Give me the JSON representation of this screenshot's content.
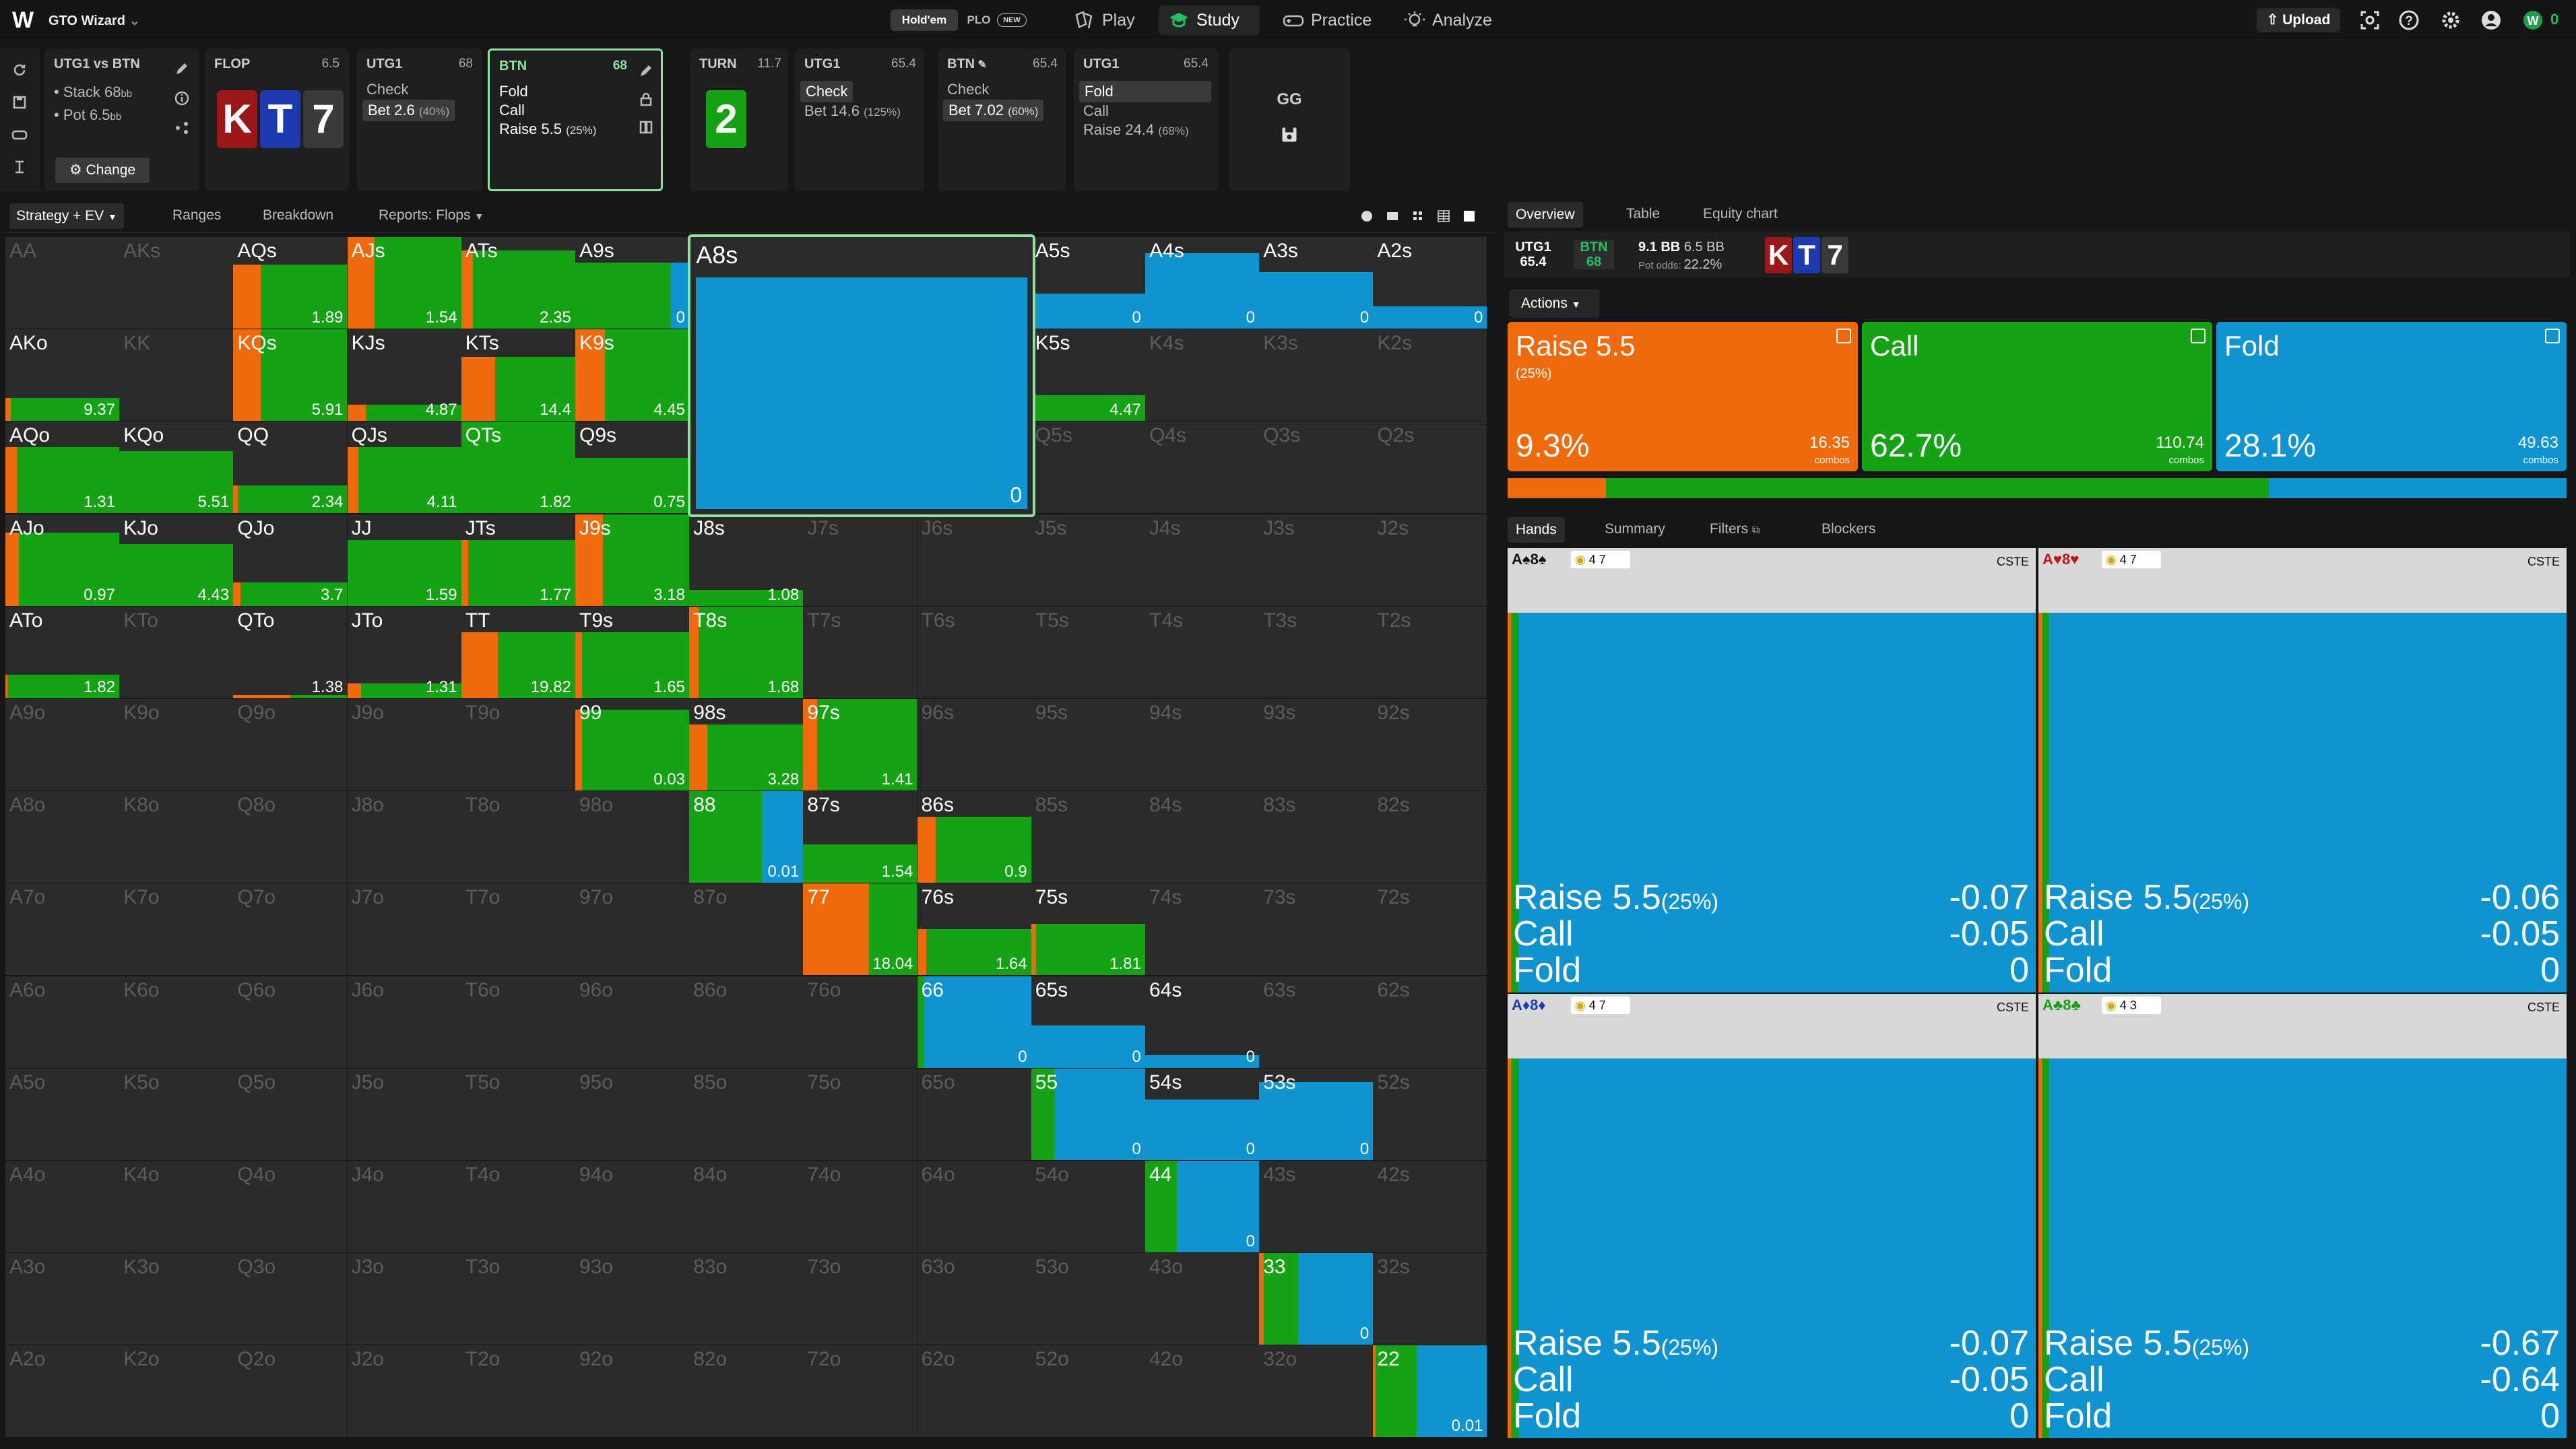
{
  "app": {
    "title": "GTO Wizard"
  },
  "topbar": {
    "toggle": [
      "Hold'em",
      "PLO",
      "NEW"
    ],
    "nav": [
      {
        "label": "Play",
        "icon": "spade-icon"
      },
      {
        "label": "Study",
        "icon": "study-icon",
        "active": true
      },
      {
        "label": "Practice",
        "icon": "gamepad-icon"
      },
      {
        "label": "Analyze",
        "icon": "bulb-icon"
      }
    ],
    "upload": "Upload",
    "right_icons": [
      "scan-icon",
      "help-icon",
      "settings-icon",
      "profile-icon"
    ],
    "balance": "0"
  },
  "spot": {
    "title": "UTG1 vs BTN",
    "stack": "Stack 68",
    "stack_unit": "bb",
    "pot": "Pot 6.5",
    "pot_unit": "bb",
    "change": "Change"
  },
  "history": [
    {
      "label": "FLOP",
      "value": "6.5",
      "board": [
        "K",
        "T",
        "7"
      ]
    },
    {
      "label": "UTG1",
      "value": "68",
      "actions": [
        "Check",
        "Bet 2.6",
        "(40%)"
      ]
    },
    {
      "label": "BTN",
      "value": "68",
      "actions": [
        "Fold",
        "Call",
        "Raise 5.5",
        "(25%)"
      ]
    },
    {
      "label": "TURN",
      "value": "11.7",
      "board": [
        "2"
      ]
    },
    {
      "label": "UTG1",
      "value": "65.4",
      "actions": [
        "Check",
        "Bet 14.6",
        "(125%)"
      ]
    },
    {
      "label": "BTN",
      "value": "65.4",
      "actions": [
        "Check",
        "Bet 7.02",
        "(60%)"
      ]
    },
    {
      "label": "UTG1",
      "value": "65.4",
      "actions": [
        "Fold",
        "Call",
        "Raise 24.4",
        "(68%)"
      ]
    },
    {
      "label": "GG"
    }
  ],
  "subtabs": [
    "Strategy + EV",
    "Ranges",
    "Breakdown",
    "Reports: Flops"
  ],
  "colors": {
    "raise": "#ef6a0c",
    "call": "#15a215",
    "fold": "#0f93d1",
    "cell_bg": "#2b2b2b",
    "selected": "#8fe39c"
  },
  "grid": {
    "rows": [
      [
        "AA",
        "AKs",
        "AQs",
        "AJs",
        "ATs",
        "A9s",
        "A8s",
        "A7s",
        "A6s",
        "A5s",
        "A4s",
        "A3s",
        "A2s"
      ],
      [
        "AKo",
        "KK",
        "KQs",
        "KJs",
        "KTs",
        "K9s",
        "K8s",
        "K7s",
        "K6s",
        "K5s",
        "K4s",
        "K3s",
        "K2s"
      ],
      [
        "AQo",
        "KQo",
        "QQ",
        "QJs",
        "QTs",
        "Q9s",
        "Q8s",
        "Q7s",
        "Q6s",
        "Q5s",
        "Q4s",
        "Q3s",
        "Q2s"
      ],
      [
        "AJo",
        "KJo",
        "QJo",
        "JJ",
        "JTs",
        "J9s",
        "J8s",
        "J7s",
        "J6s",
        "J5s",
        "J4s",
        "J3s",
        "J2s"
      ],
      [
        "ATo",
        "KTo",
        "QTo",
        "JTo",
        "TT",
        "T9s",
        "T8s",
        "T7s",
        "T6s",
        "T5s",
        "T4s",
        "T3s",
        "T2s"
      ],
      [
        "A9o",
        "K9o",
        "Q9o",
        "J9o",
        "T9o",
        "99",
        "98s",
        "97s",
        "96s",
        "95s",
        "94s",
        "93s",
        "92s"
      ],
      [
        "A8o",
        "K8o",
        "Q8o",
        "J8o",
        "T8o",
        "98o",
        "88",
        "87s",
        "86s",
        "85s",
        "84s",
        "83s",
        "82s"
      ],
      [
        "A7o",
        "K7o",
        "Q7o",
        "J7o",
        "T7o",
        "97o",
        "87o",
        "77",
        "76s",
        "75s",
        "74s",
        "73s",
        "72s"
      ],
      [
        "A6o",
        "K6o",
        "Q6o",
        "J6o",
        "T6o",
        "96o",
        "86o",
        "76o",
        "66",
        "65s",
        "64s",
        "63s",
        "62s"
      ],
      [
        "A5o",
        "K5o",
        "Q5o",
        "J5o",
        "T5o",
        "95o",
        "85o",
        "75o",
        "65o",
        "55",
        "54s",
        "53s",
        "52s"
      ],
      [
        "A4o",
        "K4o",
        "Q4o",
        "J4o",
        "T4o",
        "94o",
        "84o",
        "74o",
        "64o",
        "54o",
        "44",
        "43s",
        "42s"
      ],
      [
        "A3o",
        "K3o",
        "Q3o",
        "J3o",
        "T3o",
        "93o",
        "83o",
        "73o",
        "63o",
        "53o",
        "43o",
        "33",
        "32s"
      ],
      [
        "A2o",
        "K2o",
        "Q2o",
        "J2o",
        "T2o",
        "92o",
        "82o",
        "72o",
        "62o",
        "52o",
        "42o",
        "32o",
        "22"
      ]
    ],
    "cells": {
      "AQs": {
        "r": 0.24,
        "c": 0.76,
        "f": 0,
        "h": 0.7,
        "ev": "1.89"
      },
      "AJs": {
        "r": 0.24,
        "c": 0.76,
        "f": 0,
        "h": 1,
        "ev": "1.54"
      },
      "ATs": {
        "r": 0.1,
        "c": 0.9,
        "f": 0,
        "h": 0.85,
        "ev": "2.35"
      },
      "A9s": {
        "r": 0,
        "c": 0.84,
        "f": 0.16,
        "h": 0.72,
        "ev": "0"
      },
      "A5s": {
        "r": 0,
        "c": 0,
        "f": 1,
        "h": 0.38,
        "ev": "0"
      },
      "A4s": {
        "r": 0,
        "c": 0,
        "f": 1,
        "h": 0.82,
        "ev": "0"
      },
      "A3s": {
        "r": 0,
        "c": 0,
        "f": 1,
        "h": 0.62,
        "ev": "0"
      },
      "A2s": {
        "r": 0,
        "c": 0,
        "f": 1,
        "h": 0.24,
        "ev": "0"
      },
      "AKo": {
        "r": 0.05,
        "c": 0.95,
        "f": 0,
        "h": 0.25,
        "ev": "9.37"
      },
      "KQs": {
        "r": 0.24,
        "c": 0.76,
        "f": 0,
        "h": 1,
        "ev": "5.91"
      },
      "KJs": {
        "r": 0.16,
        "c": 0.84,
        "f": 0,
        "h": 0.18,
        "ev": "4.87"
      },
      "KTs": {
        "r": 0.3,
        "c": 0.7,
        "f": 0,
        "h": 0.7,
        "ev": "14.4"
      },
      "K9s": {
        "r": 0.26,
        "c": 0.74,
        "f": 0,
        "h": 1,
        "ev": "4.45"
      },
      "K5s": {
        "r": 0,
        "c": 1,
        "f": 0,
        "h": 0.28,
        "ev": "4.47"
      },
      "AQo": {
        "r": 0.1,
        "c": 0.9,
        "f": 0,
        "h": 0.72,
        "ev": "1.31"
      },
      "KQo": {
        "r": 0,
        "c": 1,
        "f": 0,
        "h": 0.68,
        "ev": "5.51"
      },
      "QQ": {
        "r": 0.04,
        "c": 0.96,
        "f": 0,
        "h": 0.3,
        "ev": "2.34"
      },
      "QJs": {
        "r": 0.1,
        "c": 0.9,
        "f": 0,
        "h": 0.72,
        "ev": "4.11"
      },
      "QTs": {
        "r": 0,
        "c": 1,
        "f": 0,
        "h": 1,
        "ev": "1.82"
      },
      "Q9s": {
        "r": 0,
        "c": 1,
        "f": 0,
        "h": 0.6,
        "ev": "0.75"
      },
      "AJo": {
        "r": 0.12,
        "c": 0.88,
        "f": 0,
        "h": 0.8,
        "ev": "0.97"
      },
      "KJo": {
        "r": 0,
        "c": 1,
        "f": 0,
        "h": 0.68,
        "ev": "4.43"
      },
      "QJo": {
        "r": 0.06,
        "c": 0.94,
        "f": 0,
        "h": 0.26,
        "ev": "3.7"
      },
      "JJ": {
        "r": 0,
        "c": 1,
        "f": 0,
        "h": 0.72,
        "ev": "1.59"
      },
      "JTs": {
        "r": 0.06,
        "c": 0.94,
        "f": 0,
        "h": 0.72,
        "ev": "1.77"
      },
      "J9s": {
        "r": 0.24,
        "c": 0.76,
        "f": 0,
        "h": 1,
        "ev": "3.18"
      },
      "J8s": {
        "r": 0,
        "c": 1,
        "f": 0,
        "h": 0.18,
        "ev": "1.08"
      },
      "ATo": {
        "r": 0.02,
        "c": 0.98,
        "f": 0,
        "h": 0.26,
        "ev": "1.82"
      },
      "QTo": {
        "r": 0.5,
        "c": 0.5,
        "f": 0,
        "h": 0.04,
        "ev": "1.38"
      },
      "JTo": {
        "r": 0.12,
        "c": 0.88,
        "f": 0,
        "h": 0.16,
        "ev": "1.31"
      },
      "TT": {
        "r": 0.32,
        "c": 0.68,
        "f": 0,
        "h": 0.72,
        "ev": "19.82"
      },
      "T9s": {
        "r": 0.06,
        "c": 0.94,
        "f": 0,
        "h": 0.72,
        "ev": "1.65"
      },
      "T8s": {
        "r": 0.08,
        "c": 0.92,
        "f": 0,
        "h": 1,
        "ev": "1.68"
      },
      "99": {
        "r": 0.06,
        "c": 0.94,
        "f": 0,
        "h": 0.88,
        "ev": "0.03"
      },
      "98s": {
        "r": 0.16,
        "c": 0.84,
        "f": 0,
        "h": 0.72,
        "ev": "3.28"
      },
      "97s": {
        "r": 0.12,
        "c": 0.88,
        "f": 0,
        "h": 1,
        "ev": "1.41"
      },
      "88": {
        "r": 0,
        "c": 0.64,
        "f": 0.36,
        "h": 1,
        "ev": "0.01"
      },
      "87s": {
        "r": 0,
        "c": 1,
        "f": 0,
        "h": 0.42,
        "ev": "1.54"
      },
      "86s": {
        "r": 0.16,
        "c": 0.84,
        "f": 0,
        "h": 0.72,
        "ev": "0.9"
      },
      "77": {
        "r": 0.58,
        "c": 0.42,
        "f": 0,
        "h": 1,
        "ev": "18.04"
      },
      "76s": {
        "r": 0.08,
        "c": 0.92,
        "f": 0,
        "h": 0.5,
        "ev": "1.64"
      },
      "75s": {
        "r": 0.04,
        "c": 0.96,
        "f": 0,
        "h": 0.56,
        "ev": "1.81"
      },
      "66": {
        "r": 0,
        "c": 0.06,
        "f": 0.94,
        "h": 1,
        "ev": "0"
      },
      "65s": {
        "r": 0,
        "c": 0,
        "f": 1,
        "h": 0.46,
        "ev": "0"
      },
      "64s": {
        "r": 0,
        "c": 0,
        "f": 1,
        "h": 0.14,
        "ev": "0"
      },
      "55": {
        "r": 0,
        "c": 0.2,
        "f": 0.8,
        "h": 1,
        "ev": "0"
      },
      "54s": {
        "r": 0,
        "c": 0,
        "f": 1,
        "h": 0.66,
        "ev": "0"
      },
      "53s": {
        "r": 0,
        "c": 0,
        "f": 1,
        "h": 0.85,
        "ev": "0"
      },
      "44": {
        "r": 0,
        "c": 0.28,
        "f": 0.72,
        "h": 1,
        "ev": "0"
      },
      "33": {
        "r": 0.04,
        "c": 0.3,
        "f": 0.66,
        "h": 1,
        "ev": "0"
      },
      "22": {
        "r": 0.02,
        "c": 0.36,
        "f": 0.62,
        "h": 1,
        "ev": "0.01"
      }
    },
    "selected": {
      "name": "A8s",
      "ev": "0"
    }
  },
  "right_tabs": [
    "Overview",
    "Table",
    "Equity chart"
  ],
  "info": {
    "p1": "UTG1",
    "p1_stack": "65.4",
    "p2": "BTN",
    "p2_stack": "68",
    "pot_bb": "9.1 BB",
    "pot_bb2": "6.5 BB",
    "pot_odds_label": "Pot odds:",
    "pot_odds": "22.2%",
    "board": [
      "K",
      "T",
      "7"
    ]
  },
  "actions_label": "Actions",
  "actions": [
    {
      "name": "Raise 5.5",
      "sub": "(25%)",
      "pct": "9.3%",
      "combos": "16.35",
      "combos_label": "combos",
      "color": "#ef6a0c",
      "freq": 0.093
    },
    {
      "name": "Call",
      "sub": "",
      "pct": "62.7%",
      "combos": "110.74",
      "combos_label": "combos",
      "color": "#15a215",
      "freq": 0.627
    },
    {
      "name": "Fold",
      "sub": "",
      "pct": "28.1%",
      "combos": "49.63",
      "combos_label": "combos",
      "color": "#0f93d1",
      "freq": 0.281
    }
  ],
  "hand_tabs": [
    "Hands",
    "Summary",
    "Filters",
    "Blockers"
  ],
  "hands": [
    {
      "combo": "A♠8♠",
      "blockers": "4 7",
      "tag": "CSTE",
      "raise_label": "Raise 5.5",
      "raise_sub": "(25%)",
      "raise_ev": "-0.07",
      "call_label": "Call",
      "call_ev": "-0.05",
      "fold_label": "Fold",
      "fold_ev": "0"
    },
    {
      "combo": "A♥8♥",
      "blockers": "4 7",
      "tag": "CSTE",
      "raise_label": "Raise 5.5",
      "raise_sub": "(25%)",
      "raise_ev": "-0.06",
      "call_label": "Call",
      "call_ev": "-0.05",
      "fold_label": "Fold",
      "fold_ev": "0"
    },
    {
      "combo": "A♦8♦",
      "blockers": "4 7",
      "tag": "CSTE",
      "raise_label": "Raise 5.5",
      "raise_sub": "(25%)",
      "raise_ev": "-0.07",
      "call_label": "Call",
      "call_ev": "-0.05",
      "fold_label": "Fold",
      "fold_ev": "0"
    },
    {
      "combo": "A♣8♣",
      "blockers": "4 3",
      "tag": "CSTE",
      "raise_label": "Raise 5.5",
      "raise_sub": "(25%)",
      "raise_ev": "-0.67",
      "call_label": "Call",
      "call_ev": "-0.64",
      "fold_label": "Fold",
      "fold_ev": "0"
    }
  ]
}
